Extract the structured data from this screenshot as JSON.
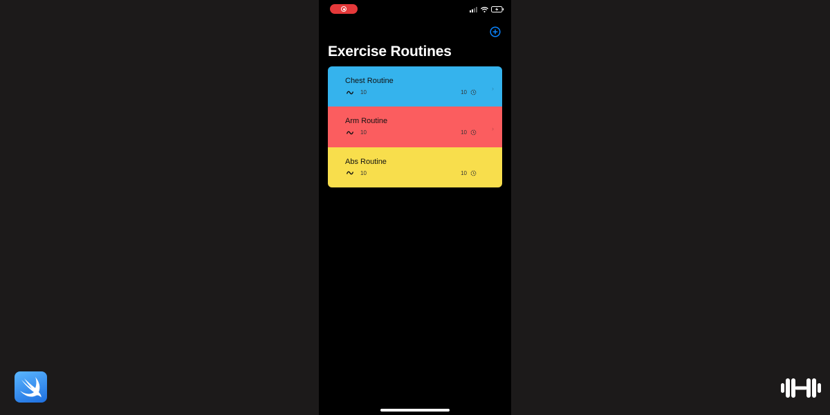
{
  "nav": {
    "title": "Exercise Routines",
    "add_icon": "plus-circle-icon"
  },
  "status_bar": {
    "recording_icon": "screen-record-icon",
    "signal_icon": "cellular-signal-icon",
    "wifi_icon": "wifi-icon",
    "battery_icon": "battery-charging-icon"
  },
  "routines": [
    {
      "name": "Chest Routine",
      "left_value": "10",
      "right_value": "10",
      "color": "#35b3ed"
    },
    {
      "name": "Arm Routine",
      "left_value": "10",
      "right_value": "10",
      "color": "#fb5d5f"
    },
    {
      "name": "Abs Routine",
      "left_value": "10",
      "right_value": "10",
      "color": "#f8de4c"
    }
  ],
  "colors": {
    "accent": "#0a84ff",
    "background": "#000000",
    "outer_background": "#1c1a1a"
  },
  "branding": {
    "left_logo": "swift-logo-icon",
    "right_logo": "dumbbell-icon"
  }
}
